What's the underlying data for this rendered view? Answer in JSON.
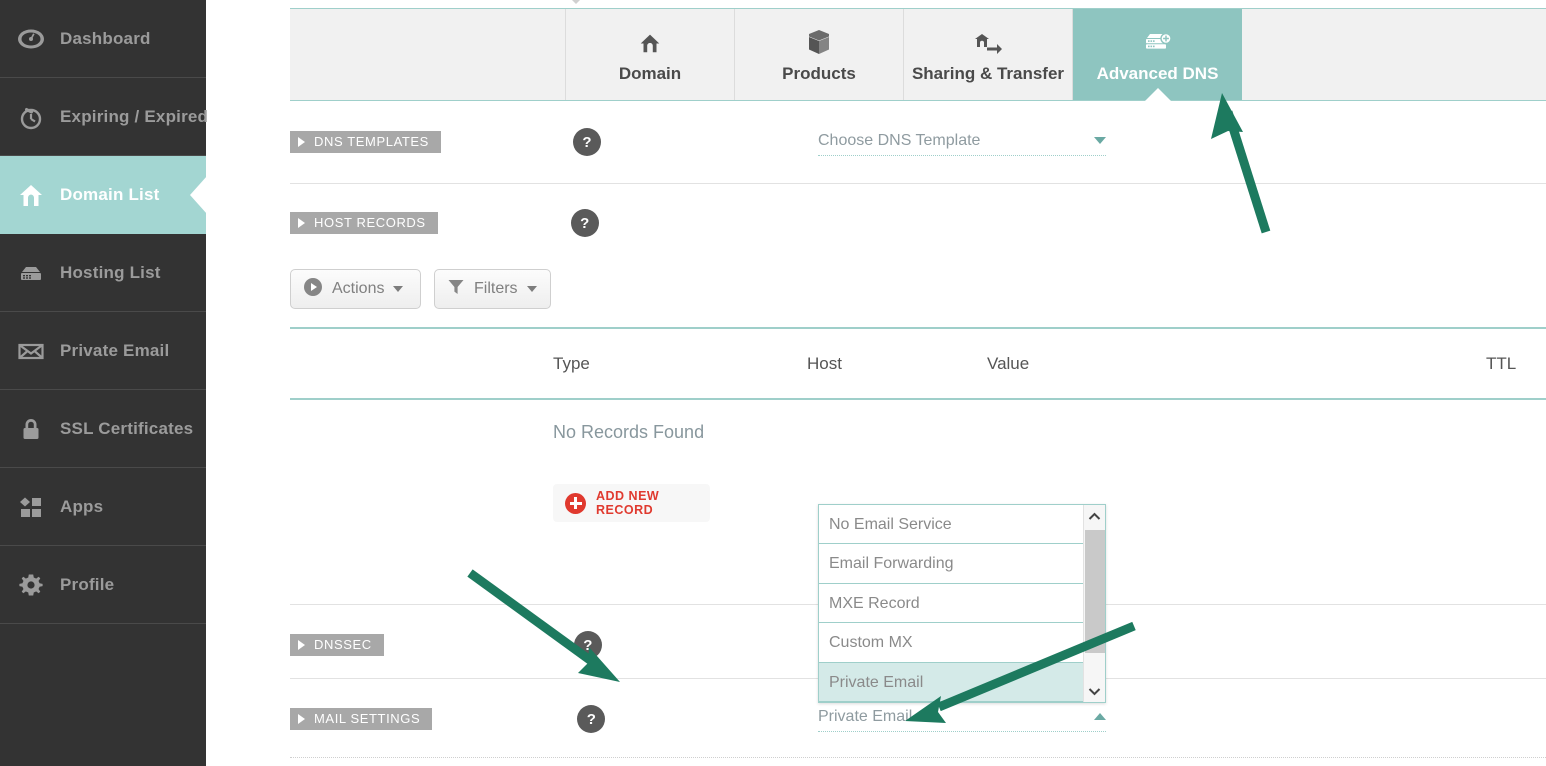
{
  "sidebar": {
    "items": [
      {
        "label": "Dashboard",
        "icon": "gauge-icon",
        "active": false
      },
      {
        "label": "Expiring / Expired",
        "icon": "stopwatch-icon",
        "active": false
      },
      {
        "label": "Domain List",
        "icon": "home-icon",
        "active": true
      },
      {
        "label": "Hosting List",
        "icon": "server-icon",
        "active": false
      },
      {
        "label": "Private Email",
        "icon": "envelope-icon",
        "active": false
      },
      {
        "label": "SSL Certificates",
        "icon": "lock-icon",
        "active": false
      },
      {
        "label": "Apps",
        "icon": "apps-icon",
        "active": false
      },
      {
        "label": "Profile",
        "icon": "gear-icon",
        "active": false
      }
    ]
  },
  "tabs": [
    {
      "label": "Domain",
      "icon": "home-icon",
      "active": false
    },
    {
      "label": "Products",
      "icon": "box-icon",
      "active": false
    },
    {
      "label": "Sharing & Transfer",
      "icon": "share-transfer-icon",
      "active": false
    },
    {
      "label": "Advanced DNS",
      "icon": "dns-server-icon",
      "active": true
    }
  ],
  "sections": {
    "dns_templates": {
      "label": "DNS TEMPLATES",
      "help": "?",
      "select_value": "Choose DNS Template"
    },
    "host_records": {
      "label": "HOST RECORDS",
      "help": "?"
    },
    "dnssec": {
      "label": "DNSSEC",
      "help": "?"
    },
    "mail_settings": {
      "label": "MAIL SETTINGS",
      "help": "?",
      "select_value": "Private Email"
    }
  },
  "toolbar": {
    "actions_label": "Actions",
    "filters_label": "Filters"
  },
  "table": {
    "columns": [
      "Type",
      "Host",
      "Value",
      "TTL"
    ],
    "empty_message": "No Records Found",
    "rows": []
  },
  "add_record_button": {
    "label": "ADD NEW RECORD",
    "icon": "plus-circle-icon"
  },
  "mail_dropdown": {
    "open": true,
    "options": [
      {
        "label": "No Email Service",
        "selected": false
      },
      {
        "label": "Email Forwarding",
        "selected": false
      },
      {
        "label": "MXE Record",
        "selected": false
      },
      {
        "label": "Custom MX",
        "selected": false
      },
      {
        "label": "Private Email",
        "selected": true
      }
    ],
    "scroll_up_glyph": "⌃",
    "scroll_down_glyph": "⌄"
  },
  "annotations": [
    {
      "name": "arrow-to-advanced-dns-tab",
      "color": "#1d7a5f"
    },
    {
      "name": "arrow-to-private-email-option",
      "color": "#1d7a5f"
    },
    {
      "name": "arrow-to-mail-settings-select",
      "color": "#1d7a5f"
    }
  ],
  "colors": {
    "sidebar_bg": "#333333",
    "accent_teal": "#8ec5c0",
    "active_nav_teal": "#a3d6d2",
    "annotation_green": "#1d7a5f",
    "danger_red": "#e0392e",
    "badge_grey": "#a8a8a8"
  }
}
